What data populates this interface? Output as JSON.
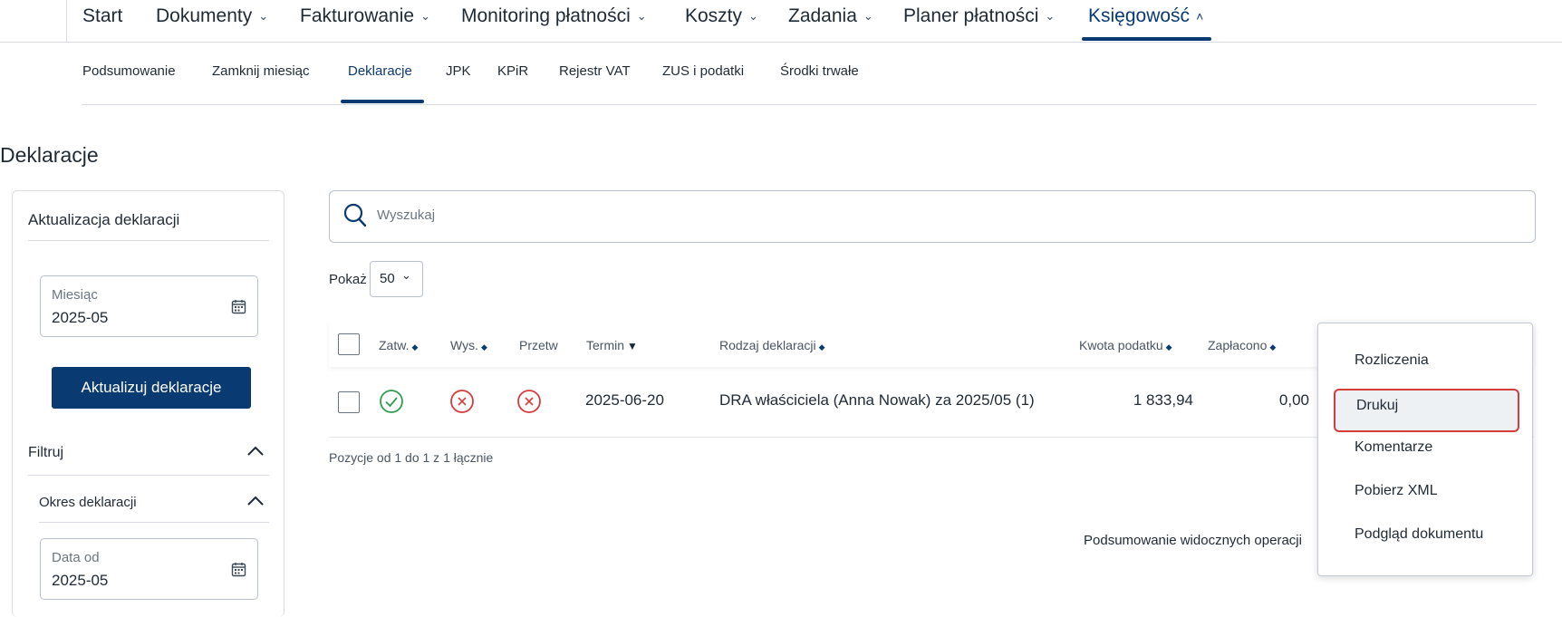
{
  "topnav": {
    "items": [
      {
        "label": "Start"
      },
      {
        "label": "Dokumenty"
      },
      {
        "label": "Fakturowanie"
      },
      {
        "label": "Monitoring płatności"
      },
      {
        "label": "Koszty"
      },
      {
        "label": "Zadania"
      },
      {
        "label": "Planer płatności"
      },
      {
        "label": "Księgowość"
      }
    ],
    "chevron_down": "⌄",
    "chevron_up": "^",
    "active": "Księgowość"
  },
  "subnav": {
    "items": [
      {
        "label": "Podsumowanie"
      },
      {
        "label": "Zamknij miesiąc"
      },
      {
        "label": "Deklaracje"
      },
      {
        "label": "JPK"
      },
      {
        "label": "KPiR"
      },
      {
        "label": "Rejestr VAT"
      },
      {
        "label": "ZUS i podatki"
      },
      {
        "label": "Środki trwałe"
      }
    ],
    "active": "Deklaracje"
  },
  "page_title": "Deklaracje",
  "sidebar": {
    "title": "Aktualizacja deklaracji",
    "month_field": {
      "label": "Miesiąc",
      "value": "2025-05"
    },
    "update_button": "Aktualizuj deklaracje",
    "filter_label": "Filtruj",
    "period_label": "Okres deklaracji",
    "date_from_field": {
      "label": "Data od",
      "value": "2025-05"
    }
  },
  "search": {
    "placeholder": "Wyszukaj"
  },
  "page_size": {
    "label": "Pokaż",
    "value": "50"
  },
  "table": {
    "headers": {
      "zatw": "Zatw.",
      "wys": "Wys.",
      "przetw": "Przetw",
      "termin": "Termin",
      "rodzaj": "Rodzaj deklaracji",
      "kwota": "Kwota podatku",
      "zaplacono": "Zapłacono"
    },
    "rows": [
      {
        "zatw": "approved",
        "wys": "rejected",
        "przetw": "rejected",
        "termin": "2025-06-20",
        "rodzaj": "DRA właściciela (Anna Nowak) za 2025/05 (1)",
        "kwota": "1 833,94",
        "zaplacono": "0,00"
      }
    ],
    "positions": "Pozycje od 1 do 1 z 1 łącznie",
    "summary": "Podsumowanie widocznych operacji"
  },
  "context_menu": {
    "items": [
      {
        "label": "Rozliczenia"
      },
      {
        "label": "Drukuj"
      },
      {
        "label": "Komentarze"
      },
      {
        "label": "Pobierz XML"
      },
      {
        "label": "Podgląd dokumentu"
      }
    ],
    "highlighted": "Drukuj"
  },
  "colors": {
    "primary": "#0a3a72",
    "success": "#2e9e4e",
    "error": "#d63c3c",
    "focus_outline": "#d63c3c"
  },
  "icons": {
    "calendar": "calendar-icon",
    "search": "search-icon",
    "check": "check-circle-icon",
    "cross": "x-circle-icon"
  }
}
